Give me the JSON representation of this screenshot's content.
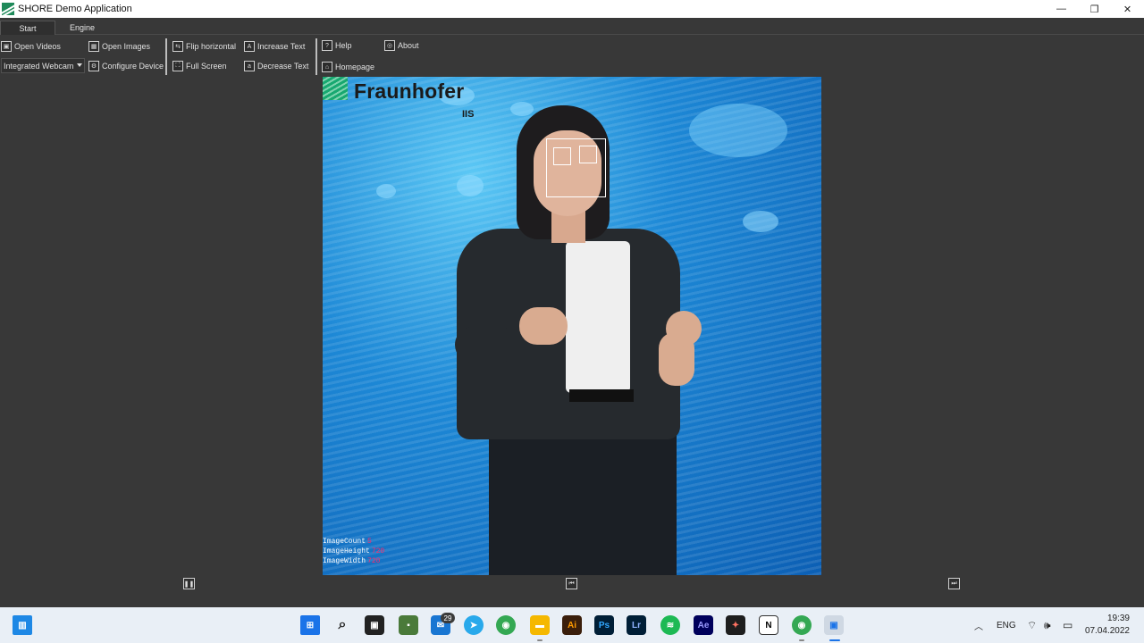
{
  "window": {
    "title": "SHORE Demo Application",
    "minimize": "—",
    "maximize": "❐",
    "close": "✕"
  },
  "tabs": [
    {
      "label": "Start"
    },
    {
      "label": "Engine"
    }
  ],
  "toolbar": {
    "open_videos": "Open Videos",
    "open_images": "Open Images",
    "flip_horizontal": "Flip horizontal",
    "increase_text": "Increase Text",
    "help": "Help",
    "about": "About",
    "device_select": "Integrated Webcam",
    "configure_device": "Configure Device",
    "full_screen": "Full Screen",
    "decrease_text": "Decrease Text",
    "homepage": "Homepage"
  },
  "video": {
    "logo_name": "Fraunhofer",
    "logo_sub": "IIS",
    "stats": [
      {
        "label": "ImageCount",
        "value": "5"
      },
      {
        "label": "ImageHeight",
        "value": "720"
      },
      {
        "label": "ImageWidth",
        "value": "720"
      }
    ]
  },
  "taskbar": {
    "mail_badge": "29",
    "language": "ENG",
    "time": "19:39",
    "date": "07.04.2022"
  },
  "colors": {
    "background": "#383838",
    "video_blue": "#1d88d6",
    "overlay_value": "#ff2a6a"
  }
}
